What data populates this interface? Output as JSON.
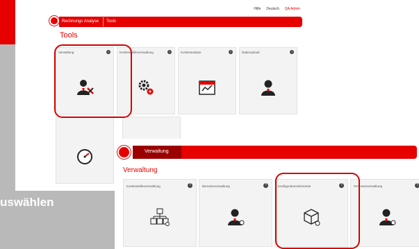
{
  "overlay": {
    "caption": "uswählen"
  },
  "screen1": {
    "links": [
      "Hilfe",
      "Deutsch",
      "QA Admin"
    ],
    "breadcrumb": [
      "Rechnungs Analyse",
      "Tools"
    ],
    "title": "Tools",
    "tiles": [
      {
        "label": "Verwaltung",
        "icon": "admin-person-icon"
      },
      {
        "label": "Kostenstellenverwaltung",
        "icon": "gears-icon"
      },
      {
        "label": "Kostenanalyse",
        "icon": "calendar-chart-icon"
      },
      {
        "label": "Datenupload",
        "icon": "person-icon"
      },
      {
        "label": "",
        "icon": "speedometer-icon"
      },
      {
        "label": "",
        "icon": "speedometer-icon"
      }
    ]
  },
  "screen2": {
    "breadcrumb": [
      "Verwaltung"
    ],
    "title": "Verwaltung",
    "tiles": [
      {
        "label": "Kostenstellenverwaltung",
        "icon": "org-chart-icon"
      },
      {
        "label": "Benutzerverwaltung",
        "icon": "user-gear-icon"
      },
      {
        "label": "Konfigurationselemente",
        "icon": "cube-gear-icon"
      },
      {
        "label": "Personenverwaltung",
        "icon": "person-gear-icon"
      }
    ]
  },
  "colors": {
    "brand_red": "#e60000",
    "dark_red": "#9b0000",
    "tile_bg": "#f3f3f3",
    "highlight": "#d40000"
  }
}
